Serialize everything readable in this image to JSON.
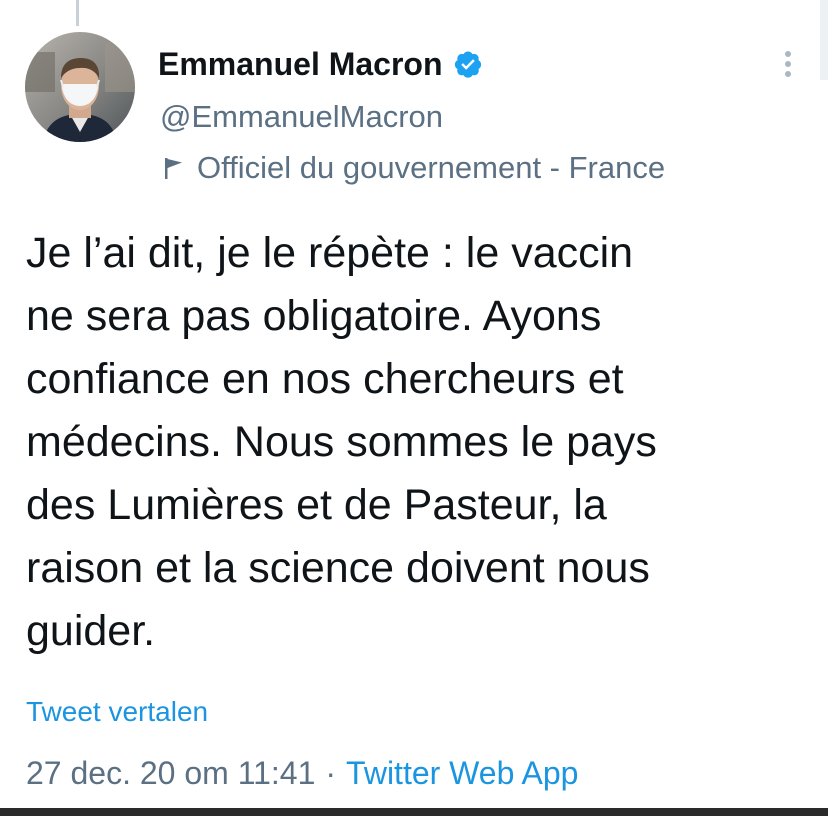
{
  "author": {
    "display_name": "Emmanuel Macron",
    "handle": "@EmmanuelMacron",
    "label": "Officiel du gouvernement - France",
    "verified": true,
    "avatar_icon": "profile-photo-masked-man"
  },
  "tweet": {
    "text": "Je l’ai dit, je le répète : le vaccin\nne sera pas obligatoire. Ayons\nconfiance en nos chercheurs et\nmédecins. Nous sommes le pays\ndes Lumières et de Pasteur, la\nraison et la science doivent nous\nguider.",
    "translate_label": "Tweet vertalen",
    "timestamp": "27 dec. 20 om 11:41",
    "separator": "·",
    "source": "Twitter Web App"
  },
  "icons": {
    "verified": "verified-badge-icon",
    "label": "flag-icon",
    "more": "more-options-icon"
  },
  "colors": {
    "accent": "#1b95e0",
    "verified": "#1da1f2",
    "secondary_text": "#5b7083",
    "primary_text": "#0f1419"
  }
}
